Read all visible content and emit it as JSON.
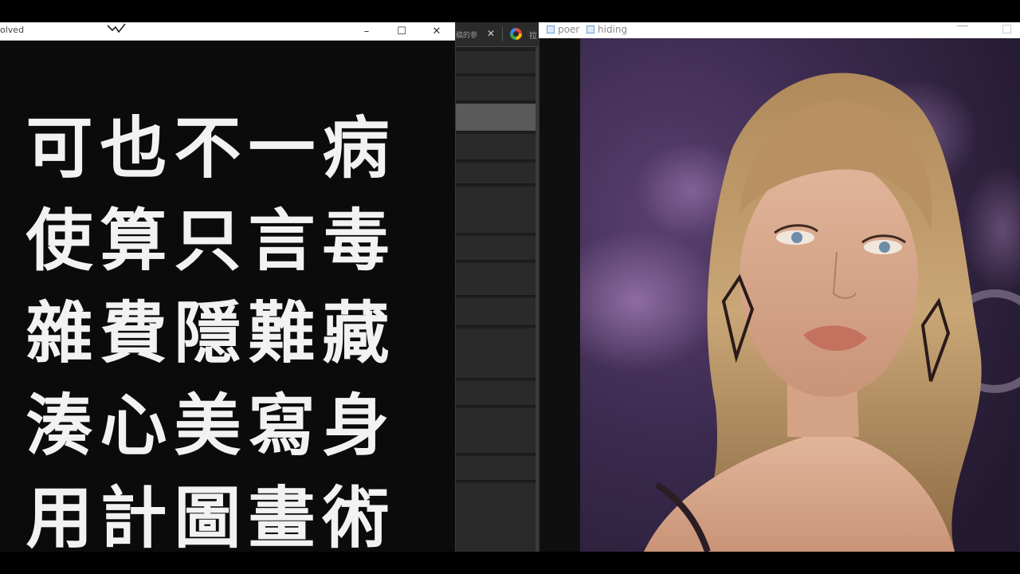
{
  "poem_window": {
    "title_fragment": "olved",
    "controls": {
      "minimize": "–",
      "maximize": "☐",
      "close": "✕"
    },
    "rows": [
      [
        "可",
        "也",
        "不",
        "一",
        "病"
      ],
      [
        "使",
        "算",
        "只",
        "言",
        "毒"
      ],
      [
        "雜",
        "費",
        "隱",
        "難",
        "藏"
      ],
      [
        "湊",
        "心",
        "美",
        "寫",
        "身"
      ],
      [
        "用",
        "計",
        "圖",
        "畫",
        "術"
      ]
    ]
  },
  "middle_app": {
    "tab_text": "稿的参",
    "tab_close": "✕",
    "tab2_text": "拉"
  },
  "image_window": {
    "tabs": [
      {
        "label": "poer",
        "icon": "window-icon"
      },
      {
        "label": "hiding",
        "icon": "window-icon"
      }
    ]
  },
  "colors": {
    "poem_bg": "#0b0b0b",
    "poem_text": "#f2f2f2",
    "titlebar_bg": "#ffffff",
    "mid_bg": "#1e1e1e",
    "mid_highlight": "#5a5a5a",
    "photo_backdrop": "#2a1f3a"
  }
}
